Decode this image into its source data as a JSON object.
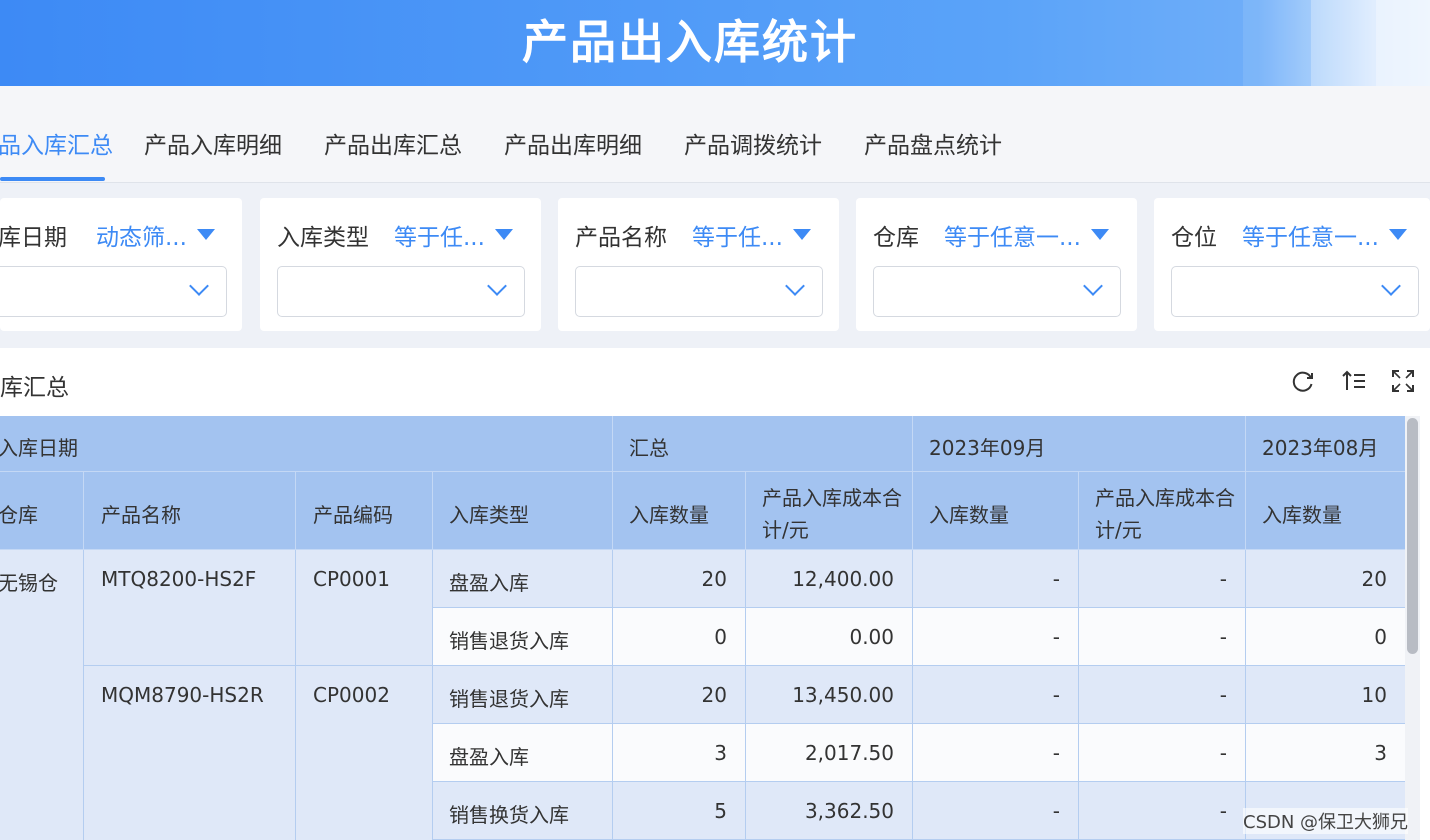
{
  "header": {
    "title": "产品出入库统计"
  },
  "tabs": [
    {
      "label": "品入库汇总",
      "active": true
    },
    {
      "label": "产品入库明细"
    },
    {
      "label": "产品出库汇总"
    },
    {
      "label": "产品出库明细"
    },
    {
      "label": "产品调拨统计"
    },
    {
      "label": "产品盘点统计"
    }
  ],
  "filters": [
    {
      "label": "库日期",
      "operator": "动态筛..."
    },
    {
      "label": "入库类型",
      "operator": "等于任..."
    },
    {
      "label": "产品名称",
      "operator": "等于任..."
    },
    {
      "label": "仓库",
      "operator": "等于任意一..."
    },
    {
      "label": "仓位",
      "operator": "等于任意一..."
    }
  ],
  "panel": {
    "title": "库汇总",
    "tools": [
      "refresh-icon",
      "sort-icon",
      "fullscreen-icon"
    ]
  },
  "table": {
    "header_top": {
      "date_dim": "入库日期",
      "total": "汇总",
      "month1": "2023年09月",
      "month2": "2023年08月"
    },
    "header_cols": {
      "warehouse": "仓库",
      "product_name": "产品名称",
      "product_code": "产品编码",
      "in_type": "入库类型",
      "total_qty": "入库数量",
      "total_cost": "产品入库成本合计/元",
      "m1_qty": "入库数量",
      "m1_cost": "产品入库成本合计/元",
      "m2_qty": "入库数量"
    },
    "warehouse": "无锡仓",
    "products": [
      {
        "name": "MTQ8200-HS2F",
        "code": "CP0001"
      },
      {
        "name": "MQM8790-HS2R",
        "code": "CP0002"
      }
    ],
    "rows": [
      {
        "type": "盘盈入库",
        "qty": "20",
        "cost": "12,400.00",
        "m1_qty": "-",
        "m1_cost": "-",
        "m2_qty": "20"
      },
      {
        "type": "销售退货入库",
        "qty": "0",
        "cost": "0.00",
        "m1_qty": "-",
        "m1_cost": "-",
        "m2_qty": "0"
      },
      {
        "type": "销售退货入库",
        "qty": "20",
        "cost": "13,450.00",
        "m1_qty": "-",
        "m1_cost": "-",
        "m2_qty": "10"
      },
      {
        "type": "盘盈入库",
        "qty": "3",
        "cost": "2,017.50",
        "m1_qty": "-",
        "m1_cost": "-",
        "m2_qty": "3"
      },
      {
        "type": "销售换货入库",
        "qty": "5",
        "cost": "3,362.50",
        "m1_qty": "-",
        "m1_cost": "-",
        "m2_qty": ""
      }
    ]
  },
  "watermark": "CSDN @保卫大狮兄",
  "colors": {
    "accent": "#3d8af5",
    "header_cell": "#a3c3f0",
    "row_stripe": "#dfe8f8"
  }
}
